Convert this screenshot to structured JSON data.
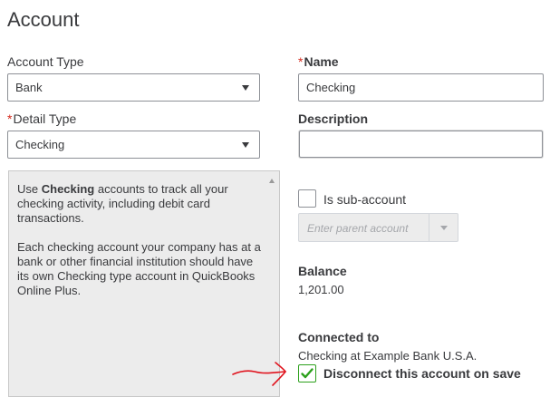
{
  "page": {
    "title": "Account"
  },
  "account_type": {
    "label": "Account Type",
    "value": "Bank",
    "caret_icon": "chevron-down-icon"
  },
  "name": {
    "required_mark": "*",
    "label": "Name",
    "value": "Checking"
  },
  "detail_type": {
    "required_mark": "*",
    "label": "Detail Type",
    "value": "Checking",
    "caret_icon": "chevron-down-icon"
  },
  "description": {
    "label": "Description",
    "value": ""
  },
  "help": {
    "p1_pre": "Use ",
    "p1_bold": "Checking",
    "p1_post": " accounts to track all your checking activity, including debit card transactions.",
    "p2": "Each checking account your company has at a bank or other financial institution should have its own Checking type account in QuickBooks Online Plus."
  },
  "sub_account": {
    "label": "Is sub-account",
    "checked": false,
    "parent_placeholder": "Enter parent account"
  },
  "balance": {
    "label": "Balance",
    "value": "1,201.00"
  },
  "connected": {
    "label": "Connected to",
    "value": "Checking at Example Bank U.S.A.",
    "disconnect_label": "Disconnect this account on save",
    "disconnect_checked": true
  },
  "colors": {
    "required": "#d52b1e",
    "check_green": "#2ca01c",
    "annotation_arrow": "#e0141e"
  }
}
